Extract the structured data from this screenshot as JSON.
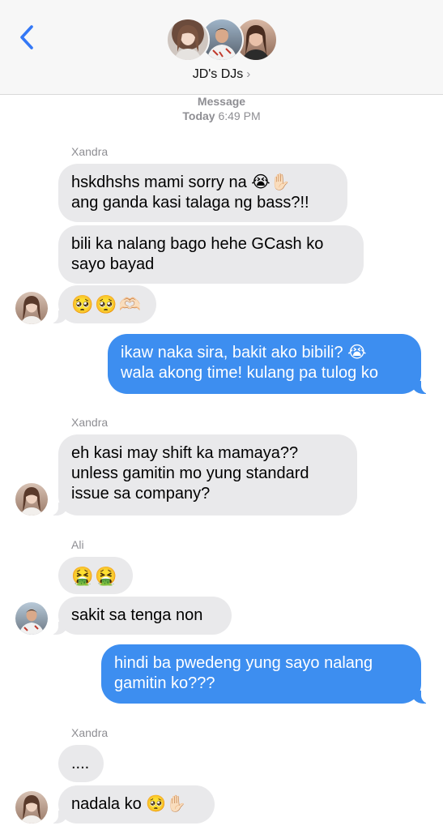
{
  "header": {
    "group_name": "JD's DJs",
    "chevron": "›",
    "back_icon": "chevron-left-icon",
    "accent": "#3478f6"
  },
  "meta": {
    "service": "Message",
    "day": "Today",
    "time": "6:49 PM"
  },
  "colors": {
    "incoming": "#e9e9eb",
    "outgoing": "#3d8ef0"
  },
  "thread": {
    "sender_1": "Xandra",
    "msg_1": "hskdhshs mami sorry na 😭✋🏻\nang ganda kasi talaga ng bass?!!",
    "msg_2": "bili ka nalang bago hehe GCash ko\nsayo bayad",
    "msg_3": "🥺🥺🫶🏻",
    "msg_4": "ikaw naka sira, bakit ako bibili? 😭\nwala akong time! kulang pa tulog ko",
    "sender_2": "Xandra",
    "msg_5": "eh kasi may shift ka mamaya??\nunless gamitin mo yung standard\nissue sa company?",
    "sender_3": "Ali",
    "msg_6": "🤮🤮",
    "msg_7": "sakit sa tenga non",
    "msg_8": "hindi ba pwedeng yung sayo nalang\ngamitin ko???",
    "sender_4": "Xandra",
    "msg_9": "....",
    "msg_10": "nadala ko 🥺✋🏻"
  }
}
